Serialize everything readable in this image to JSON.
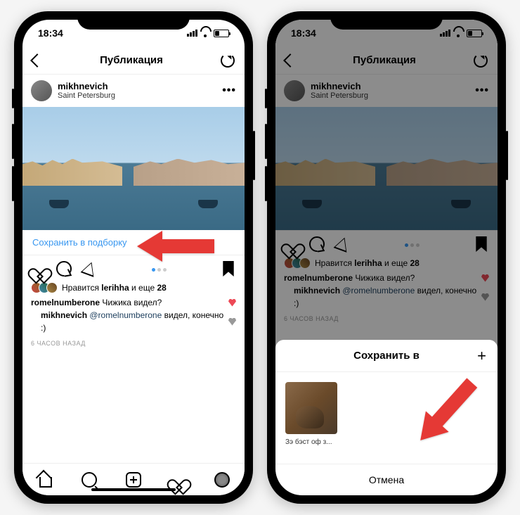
{
  "status": {
    "time": "18:34"
  },
  "nav": {
    "title": "Публикация"
  },
  "post": {
    "username": "mikhnevich",
    "location": "Saint Petersburg",
    "save_collection": "Сохранить в подборку",
    "likes_prefix": "Нравится",
    "likes_user": "lerihha",
    "likes_and": "и еще",
    "likes_count": "28",
    "comment1_user": "romelnumberone",
    "comment1_text": "Чижика видел?",
    "comment2_user": "mikhnevich",
    "comment2_mention": "@romelnumberone",
    "comment2_text": "видел, конечно :)",
    "timestamp": "6 ЧАСОВ НАЗАД"
  },
  "sheet": {
    "title": "Сохранить в",
    "collection_name": "Зэ бэст оф з...",
    "cancel": "Отмена"
  }
}
